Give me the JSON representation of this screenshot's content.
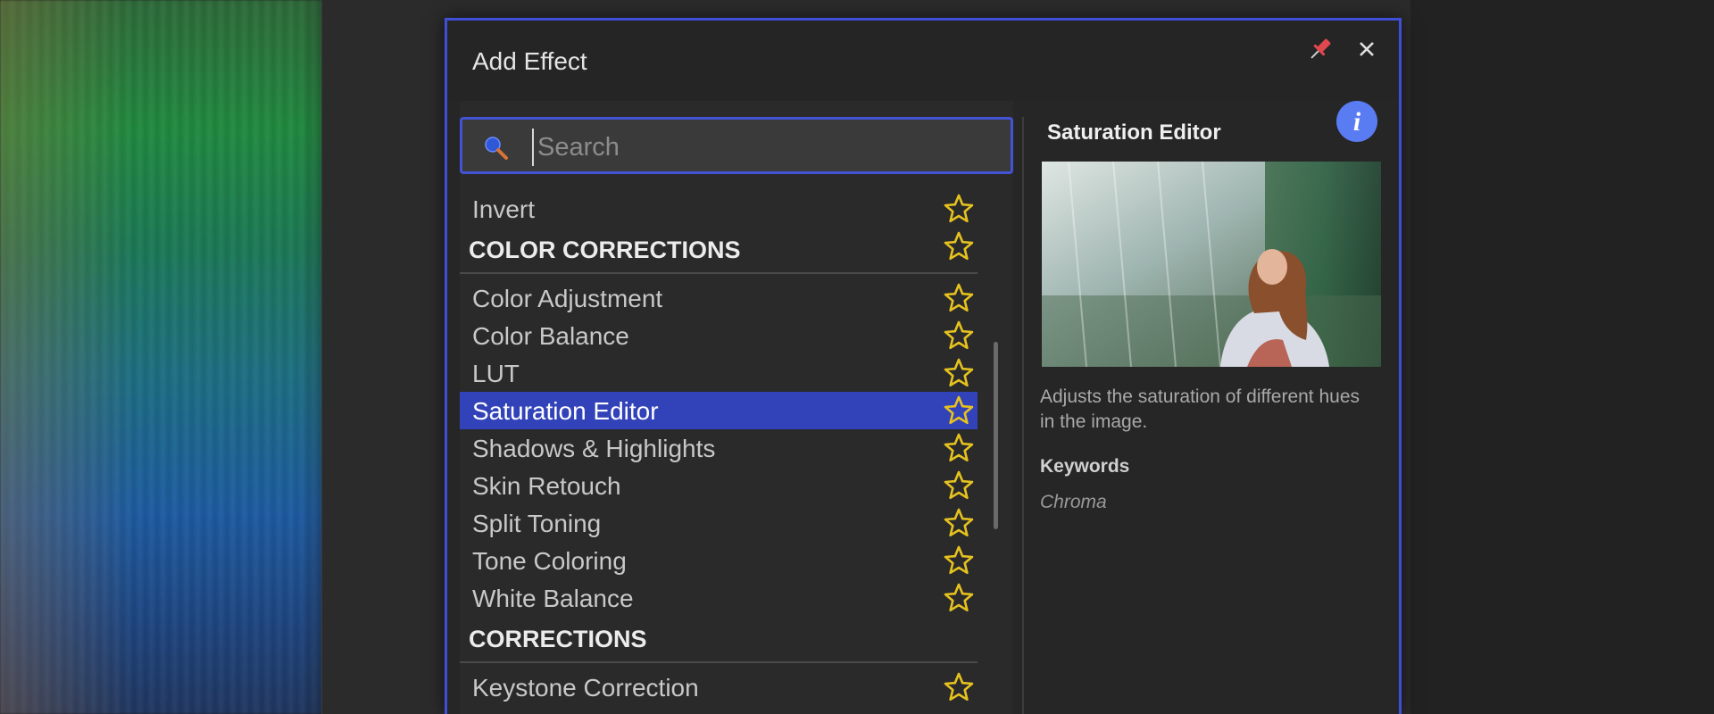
{
  "dialog": {
    "title": "Add Effect",
    "accent_color": "#3f4fd8",
    "star_color": "#e6c21f",
    "pin_icon": "pin-icon",
    "close_icon": "close-icon"
  },
  "search": {
    "placeholder": "Search",
    "value": "",
    "icon": "search-icon"
  },
  "list": {
    "rows": [
      {
        "type": "item",
        "label": "Invert",
        "favorite": false
      },
      {
        "type": "category",
        "label": "COLOR CORRECTIONS"
      },
      {
        "type": "item",
        "label": "Color Adjustment",
        "favorite": false
      },
      {
        "type": "item",
        "label": "Color Balance",
        "favorite": false
      },
      {
        "type": "item",
        "label": "LUT",
        "favorite": false
      },
      {
        "type": "item",
        "label": "Saturation Editor",
        "favorite": false,
        "selected": true
      },
      {
        "type": "item",
        "label": "Shadows & Highlights",
        "favorite": false
      },
      {
        "type": "item",
        "label": "Skin Retouch",
        "favorite": false
      },
      {
        "type": "item",
        "label": "Split Toning",
        "favorite": false
      },
      {
        "type": "item",
        "label": "Tone Coloring",
        "favorite": false
      },
      {
        "type": "item",
        "label": "White Balance",
        "favorite": false
      },
      {
        "type": "category",
        "label": "CORRECTIONS"
      },
      {
        "type": "item",
        "label": "Keystone Correction",
        "favorite": false
      }
    ]
  },
  "details": {
    "title": "Saturation Editor",
    "description": "Adjusts the saturation of different hues in the image.",
    "keywords_heading": "Keywords",
    "keywords": "Chroma",
    "info_icon": "info-icon"
  }
}
